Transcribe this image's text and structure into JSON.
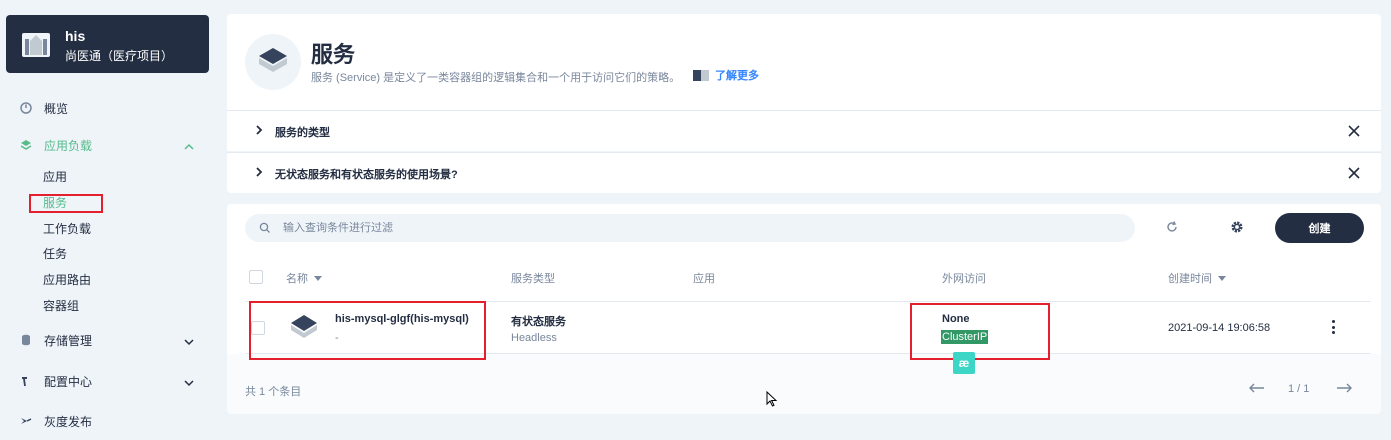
{
  "project": {
    "name": "his",
    "subtitle": "尚医通（医疗项目）"
  },
  "nav": {
    "overview": "概览",
    "workloads": "应用负载",
    "sub_items": [
      "应用",
      "服务",
      "工作负载",
      "任务",
      "应用路由",
      "容器组"
    ],
    "storage": "存储管理",
    "config": "配置中心",
    "grayscale": "灰度发布"
  },
  "header": {
    "title": "服务",
    "description": "服务 (Service) 是定义了一类容器组的逻辑集合和一个用于访问它们的策略。",
    "learn_more": "了解更多"
  },
  "faq": [
    "服务的类型",
    "无状态服务和有状态服务的使用场景?"
  ],
  "toolbar": {
    "search_placeholder": "输入查询条件进行过滤",
    "create_label": "创建"
  },
  "table": {
    "columns": [
      "名称",
      "服务类型",
      "应用",
      "外网访问",
      "创建时间"
    ],
    "rows": [
      {
        "name": "his-mysql-glgf(his-mysql)",
        "description": "-",
        "type": "有状态服务",
        "type_sub": "Headless",
        "app": "",
        "external": "None",
        "external_sub": "ClusterIP",
        "created": "2021-09-14 19:06:58"
      }
    ]
  },
  "footer": {
    "total": "共 1 个条目",
    "page": "1 / 1"
  },
  "float_badge": "æ",
  "colors": {
    "accent": "#55bc8a",
    "dark": "#242e42",
    "highlight": "#e5202e",
    "tag": "#329866"
  }
}
